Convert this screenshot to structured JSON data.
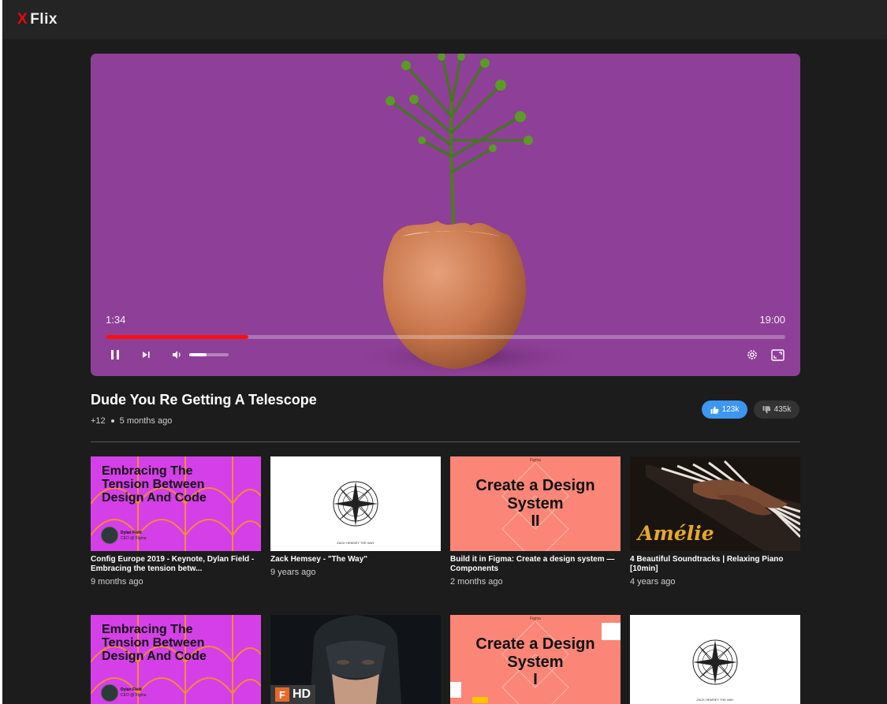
{
  "app": {
    "logo_mark": "X",
    "name": "Flix",
    "brand_color": "#e50914"
  },
  "player": {
    "current_time": "1:34",
    "total_time": "19:00",
    "progress_fraction": 0.21,
    "volume_fraction": 0.44,
    "icons": [
      "pause-icon",
      "skip-next-icon",
      "volume-icon",
      "settings-gear-icon",
      "fullscreen-icon"
    ]
  },
  "video": {
    "title": "Dude You Re Getting A Telescope",
    "extra": "+12",
    "age": "5 months ago",
    "likes": "123k",
    "dislikes": "435k"
  },
  "accent_colors": {
    "like": "#3d96f0",
    "progress": "#ff1010",
    "player_bg": "#8e3f97"
  },
  "grid": [
    {
      "kind": "config",
      "thumb_text": "Embracing The Tension Between Design And Code",
      "speaker": "Dylan Field",
      "speaker_role": "CEO @ Figma",
      "title": "Config Europe 2019 - Keynote, Dylan Field - Embracing the tension betw...",
      "age": "9 months ago"
    },
    {
      "kind": "compass",
      "thumb_caption": "ZACK HEMSEY THE WAY",
      "title": "Zack Hemsey - \"The Way\"",
      "age": "9 years ago"
    },
    {
      "kind": "design-system",
      "thumb_label": "Figma",
      "thumb_text": "Create a Design System",
      "thumb_num": "II",
      "title": "Build it in Figma: Create a design system — Components",
      "age": "2 months ago"
    },
    {
      "kind": "piano",
      "thumb_text": "Amélie",
      "title": "4 Beautiful Soundtracks | Relaxing Piano [10min]",
      "age": "4 years ago"
    },
    {
      "kind": "config",
      "thumb_text": "Embracing The Tension Between Design And Code",
      "speaker": "Dylan Field",
      "speaker_role": "CEO @ Figma"
    },
    {
      "kind": "batman",
      "thumb_badge_letter": "F",
      "thumb_badge": "HD"
    },
    {
      "kind": "design-system",
      "thumb_label": "Figma",
      "thumb_text": "Create a Design System",
      "thumb_num": "I"
    },
    {
      "kind": "compass",
      "thumb_caption": "ZACK HEMSEY THE WAY"
    }
  ]
}
